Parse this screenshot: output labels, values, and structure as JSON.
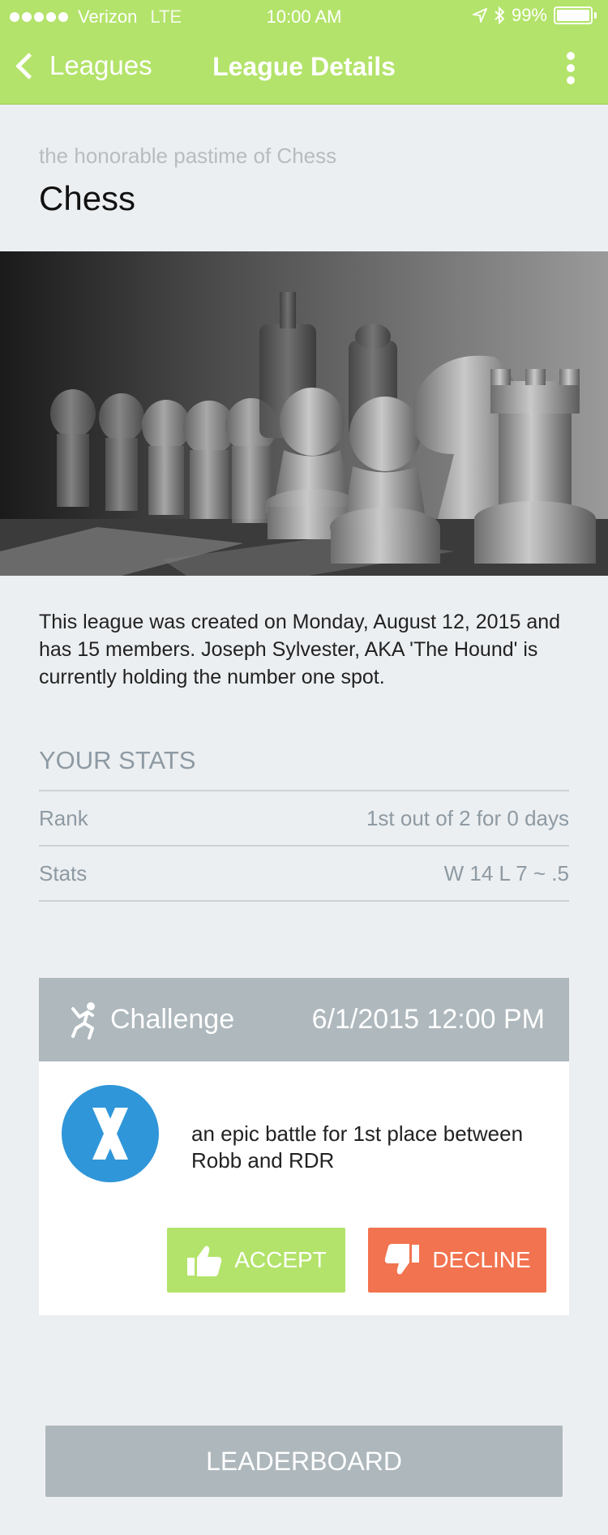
{
  "status_bar": {
    "carrier": "Verizon",
    "network": "LTE",
    "time": "10:00 AM",
    "battery": "99%"
  },
  "nav": {
    "back_label": "Leagues",
    "title": "League Details"
  },
  "league": {
    "subtitle": "the honorable pastime of Chess",
    "title": "Chess",
    "description": "This league was created on Monday, August 12, 2015 and has 15 members. Joseph Sylvester, AKA 'The Hound' is currently holding the number one spot."
  },
  "stats": {
    "heading": "YOUR STATS",
    "rows": [
      {
        "label": "Rank",
        "value": "1st out of 2 for 0 days"
      },
      {
        "label": "Stats",
        "value": "W 14 L 7 ~ .5"
      }
    ]
  },
  "challenge": {
    "label": "Challenge",
    "date": "6/1/2015 12:00 PM",
    "description": "an epic battle for 1st place between Robb and RDR",
    "accept_label": "ACCEPT",
    "decline_label": "DECLINE"
  },
  "leaderboard_label": "LEADERBOARD",
  "colors": {
    "accent_green": "#b3e36a",
    "decline_orange": "#f2734f",
    "header_gray": "#aeb8bd",
    "avatar_blue": "#2f96d9",
    "background": "#eceff1"
  }
}
